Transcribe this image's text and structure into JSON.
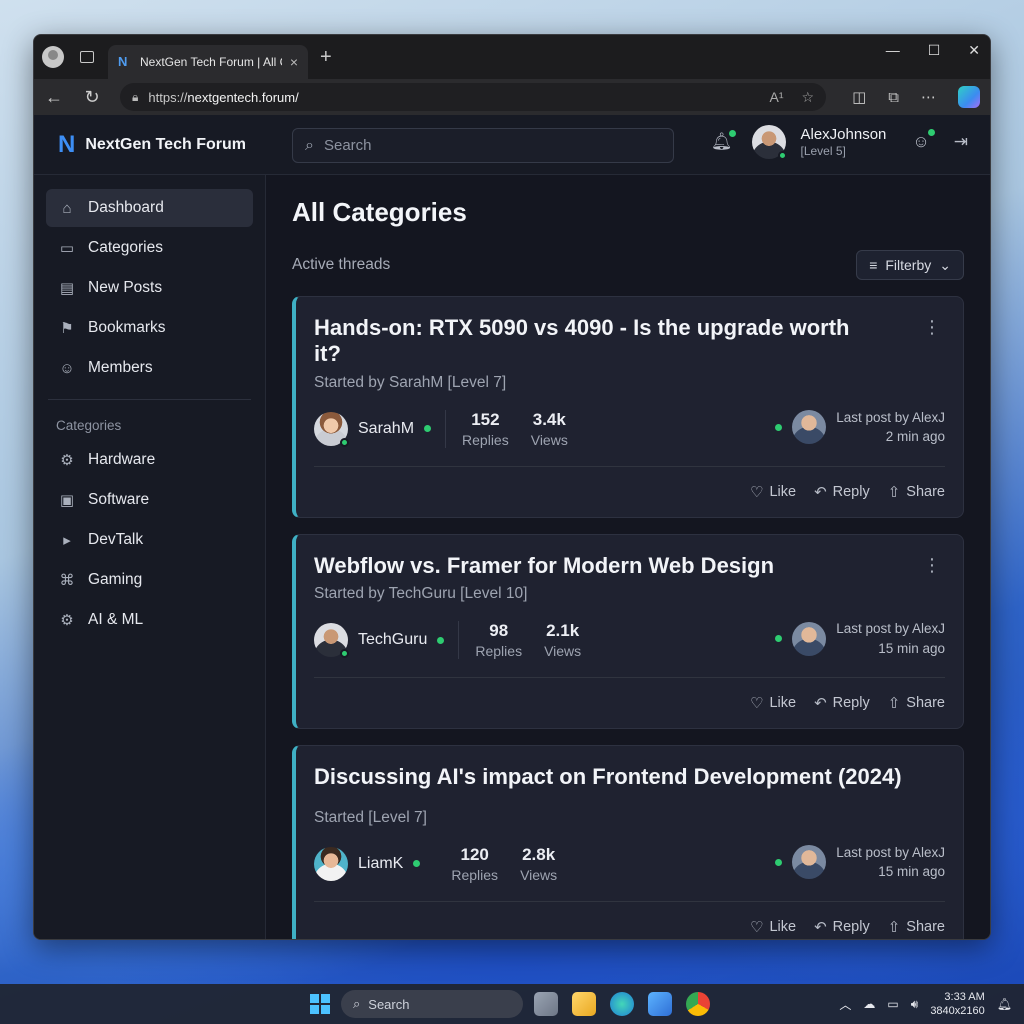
{
  "browser": {
    "tab_title": "NextGen Tech Forum | All Cat",
    "url_prefix": "https://",
    "url_host": "nextgentech.forum/",
    "read_aloud_label": "A¹",
    "window_minimize": "—",
    "window_maximize": "☐",
    "window_close": "✕"
  },
  "header": {
    "logo_mark": "N",
    "site_name": "NextGen Tech Forum",
    "search_placeholder": "Search",
    "user_name": "AlexJohnson",
    "user_level": "[Level 5]"
  },
  "sidebar": {
    "items": [
      {
        "label": "Dashboard",
        "icon": "home-icon",
        "glyph": "⌂"
      },
      {
        "label": "Categories",
        "icon": "folder-icon",
        "glyph": "▭"
      },
      {
        "label": "New Posts",
        "icon": "new-posts-icon",
        "glyph": "▤"
      },
      {
        "label": "Bookmarks",
        "icon": "bookmark-icon",
        "glyph": "⚑"
      },
      {
        "label": "Members",
        "icon": "members-icon",
        "glyph": "☺"
      }
    ],
    "categories_heading": "Categories",
    "categories": [
      {
        "label": "Hardware",
        "icon": "chip-icon",
        "glyph": "⚙"
      },
      {
        "label": "Software",
        "icon": "window-icon",
        "glyph": "▣"
      },
      {
        "label": "DevTalk",
        "icon": "terminal-icon",
        "glyph": "▸"
      },
      {
        "label": "Gaming",
        "icon": "gamepad-icon",
        "glyph": "⌘"
      },
      {
        "label": "AI & ML",
        "icon": "gear-icon",
        "glyph": "⚙"
      }
    ]
  },
  "main": {
    "title": "All Categories",
    "subtitle": "Active threads",
    "filter_label": "Filterby",
    "threads": [
      {
        "title": "Hands-on: RTX 5090 vs 4090 - Is the upgrade worth it?",
        "started": "Started by SarahM [Level 7]",
        "author": "SarahM",
        "replies": "152",
        "replies_label": "Replies",
        "views": "3.4k",
        "views_label": "Views",
        "last_post": "Last post by AlexJ",
        "last_time": "2 min ago",
        "like": "Like",
        "reply": "Reply",
        "share": "Share"
      },
      {
        "title": "Webflow vs. Framer for Modern Web Design",
        "started": "Started by TechGuru [Level 10]",
        "author": "TechGuru",
        "replies": "98",
        "replies_label": "Replies",
        "views": "2.1k",
        "views_label": "Views",
        "last_post": "Last post by AlexJ",
        "last_time": "15 min ago",
        "like": "Like",
        "reply": "Reply",
        "share": "Share"
      },
      {
        "title": "Discussing AI's impact on Frontend Development (2024)",
        "started": "Started [Level 7]",
        "author": "LiamK",
        "replies": "120",
        "replies_label": "Replies",
        "views": "2.8k",
        "views_label": "Views",
        "last_post": "Last post by AlexJ",
        "last_time": "15 min ago",
        "like": "Like",
        "reply": "Reply",
        "share": "Share"
      }
    ]
  },
  "taskbar": {
    "search_label": "Search",
    "time": "3:33 AM",
    "resolution": "3840x2160"
  },
  "colors": {
    "accent": "#3fb0c4",
    "online": "#2ecc71",
    "logo": "#3d8ef5"
  }
}
